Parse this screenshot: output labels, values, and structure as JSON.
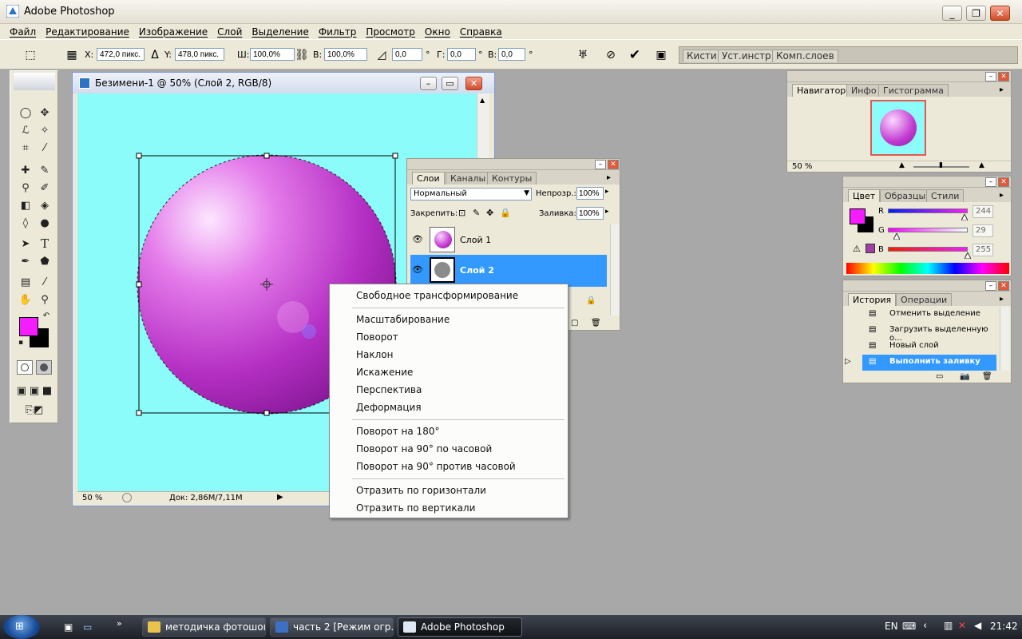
{
  "app": {
    "title": "Adobe Photoshop",
    "colors": {
      "accent_blue": "#3399ff",
      "foreground": "#f41dff",
      "background": "#000000",
      "canvas": "#8bfcfa"
    }
  },
  "menu": [
    "Файл",
    "Редактирование",
    "Изображение",
    "Слой",
    "Выделение",
    "Фильтр",
    "Просмотр",
    "Окно",
    "Справка"
  ],
  "options": {
    "x_label": "X:",
    "x_value": "472,0 пикс.",
    "y_label": "Y:",
    "y_value": "478,0 пикс.",
    "w_label": "Ш:",
    "w_value": "100,0%",
    "h_label": "В:",
    "h_value": "100,0%",
    "angle_value": "0,0",
    "angle_unit": "°",
    "hskew_label": "Г:",
    "hskew_value": "0,0",
    "vskew_label": "В:",
    "vskew_value": "0,0",
    "well_tabs": [
      "Кисти",
      "Уст.инстр.",
      "Комп.слоев"
    ]
  },
  "document": {
    "title": "Безимени-1 @ 50% (Слой 2, RGB/8)",
    "zoom": "50 %",
    "doc_size": "Док: 2,86M/7,11M"
  },
  "layers": {
    "tabs": [
      "Слои",
      "Каналы",
      "Контуры"
    ],
    "blend_mode": "Нормальный",
    "opacity_label": "Непрозр.:",
    "opacity_value": "100%",
    "lock_label": "Закрепить:",
    "fill_label": "Заливка:",
    "fill_value": "100%",
    "rows": [
      {
        "name": "Слой 1"
      },
      {
        "name": "Слой 2"
      }
    ]
  },
  "context_menu": {
    "items": [
      "Свободное трансформирование",
      "Масштабирование",
      "Поворот",
      "Наклон",
      "Искажение",
      "Перспектива",
      "Деформация",
      "Поворот на 180°",
      "Поворот на 90° по часовой",
      "Поворот на 90° против часовой",
      "Отразить по горизонтали",
      "Отразить по вертикали"
    ]
  },
  "navigator": {
    "tabs": [
      "Навигатор",
      "Инфо",
      "Гистограмма"
    ],
    "zoom": "50 %"
  },
  "color_panel": {
    "tabs": [
      "Цвет",
      "Образцы",
      "Стили"
    ],
    "r_label": "R",
    "r_value": "244",
    "g_label": "G",
    "g_value": "29",
    "b_label": "B",
    "b_value": "255",
    "r": 244,
    "g": 29,
    "b": 255
  },
  "history": {
    "tabs": [
      "История",
      "Операции"
    ],
    "items": [
      "Отменить выделение",
      "Загрузить выделенную о...",
      "Новый слой",
      "Выполнить заливку"
    ]
  },
  "taskbar": {
    "items": [
      "методичка фотошоп",
      "часть 2 [Режим огр...",
      "Adobe Photoshop"
    ],
    "lang": "EN",
    "time": "21:42"
  }
}
